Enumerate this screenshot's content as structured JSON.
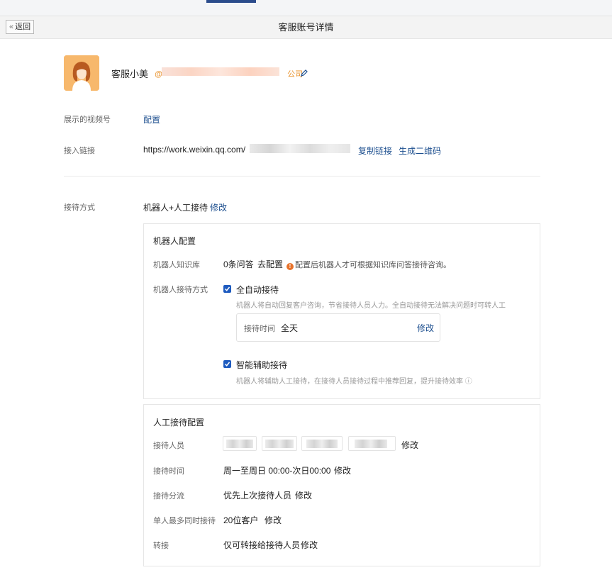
{
  "header": {
    "back_label": "返回",
    "back_chevron": "«",
    "title": "客服账号详情"
  },
  "account": {
    "name": "客服小美",
    "corp_prefix": "@",
    "corp_suffix": "公司"
  },
  "fields": {
    "video_label": "展示的视频号",
    "video_action": "配置",
    "link_label": "接入链接",
    "link_value": "https://work.weixin.qq.com/",
    "copy_link": "复制链接",
    "gen_qr": "生成二维码",
    "mode_label": "接待方式",
    "mode_value": "机器人+人工接待",
    "mode_edit": "修改"
  },
  "robot": {
    "title": "机器人配置",
    "kb_label": "机器人知识库",
    "kb_value": "0条问答",
    "kb_action": "去配置",
    "kb_warn": "配置后机器人才可根据知识库问答接待咨询。",
    "kb_warn_icon": "!",
    "mode_label": "机器人接待方式",
    "auto_label": "全自动接待",
    "auto_desc": "机器人将自动回复客户咨询，节省接待人员人力。全自动接待无法解决问题时可转人工",
    "time_label": "接待时间",
    "time_value": "全天",
    "time_edit": "修改",
    "assist_label": "智能辅助接待",
    "assist_desc": "机器人将辅助人工接待，在接待人员接待过程中推荐回复，提升接待效率",
    "assist_info_icon": "ⓘ"
  },
  "manual": {
    "title": "人工接待配置",
    "staff_label": "接待人员",
    "staff_edit": "修改",
    "time_label": "接待时间",
    "time_value": "周一至周日 00:00-次日00:00",
    "time_edit": "修改",
    "dist_label": "接待分流",
    "dist_value": "优先上次接待人员",
    "dist_edit": "修改",
    "max_label": "单人最多同时接待",
    "max_value": "20位客户",
    "max_edit": "修改",
    "transfer_label": "转接",
    "transfer_value": "仅可转接给接待人员",
    "transfer_edit": "修改"
  },
  "colors": {
    "link": "#1d4f8f",
    "checkbox": "#1e5bbf",
    "warn": "#e8722a",
    "corp": "#e8912a",
    "avatar_bg": "#f7b86c"
  }
}
